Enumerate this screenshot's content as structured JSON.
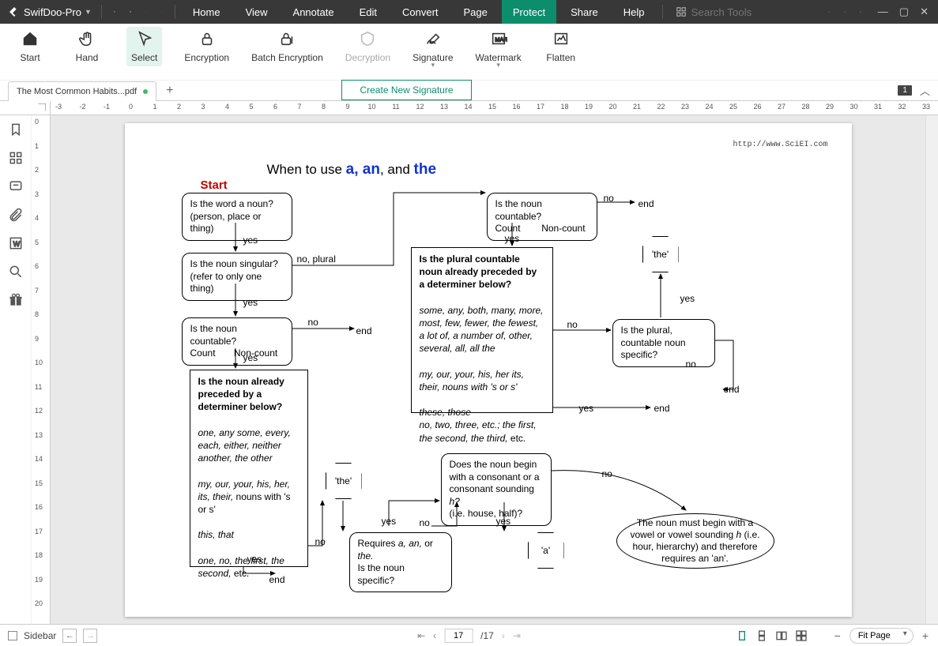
{
  "app": {
    "name": "SwifDoo-Pro"
  },
  "menus": [
    "Home",
    "View",
    "Annotate",
    "Edit",
    "Convert",
    "Page",
    "Protect",
    "Share",
    "Help"
  ],
  "active_menu": "Protect",
  "search_placeholder": "Search Tools",
  "ribbon": {
    "start": "Start",
    "hand": "Hand",
    "select": "Select",
    "encryption": "Encryption",
    "batch": "Batch Encryption",
    "decryption": "Decryption",
    "signature": "Signature",
    "watermark": "Watermark",
    "flatten": "Flatten"
  },
  "sig_dropdown": "Create New Signature",
  "tab": {
    "name": "The Most Common Habits...pdf"
  },
  "page_badge": "1",
  "h_ruler": [
    -3,
    -2,
    -1,
    0,
    1,
    2,
    3,
    4,
    5,
    6,
    7,
    8,
    9,
    10,
    11,
    12,
    13,
    14,
    15,
    16,
    17,
    18,
    19,
    20,
    21,
    22,
    23,
    24,
    25,
    26,
    27,
    28,
    29,
    30,
    31,
    32,
    33
  ],
  "v_ruler": [
    0,
    1,
    2,
    3,
    4,
    5,
    6,
    7,
    8,
    9,
    10,
    11,
    12,
    13,
    14,
    15,
    16,
    17,
    18,
    19,
    20
  ],
  "doc": {
    "url": "http://www.SciEI.com",
    "title_prefix": "When to use ",
    "title_a": "a, an",
    "title_and": ", and ",
    "title_the": "the",
    "start": "Start",
    "n1a": "Is the word a noun?",
    "n1b": "(person, place or thing)",
    "n2a": "Is the noun singular?",
    "n2b": "(refer to only one thing)",
    "n3a": "Is the noun countable?",
    "n3b": "Count",
    "n3c": "Non-count",
    "n4t": "Is the noun already preceded by a determiner below?",
    "n4a": "one, any some, every, each, either, neither another, the other",
    "n4b": "my, our, your, his, her, its, their, ",
    "n4b2": "nouns with 's or s'",
    "n4c": "this, that",
    "n4d": "one, no, the first, the second, ",
    "n4d2": "etc.",
    "n5a": "Is the noun countable?",
    "n5b": "Count",
    "n5c": "Non-count",
    "n6t": "Is the plural countable noun already preceded by a determiner below?",
    "n6a": "some, any, both, many, more, most, few, fewer, the fewest, a lot of, a number of, other, several, all, all the",
    "n6b": "my, our, your, his, her its, their, nouns with 's or s'",
    "n6c": "these, those",
    "n6d": "no, two, three, etc.; the first, the second, the third, ",
    "n6d2": "etc.",
    "n7": "Is the plural, countable noun specific?",
    "n8a": "Does the noun begin with a consonant or a consonant sounding ",
    "n8b": "h?",
    "n8c": "(i.e. house, half)?",
    "n9a": "Requires ",
    "n9b": "a, an, ",
    "n9c": "or ",
    "n9d": "the.",
    "n9e": "Is the noun specific?",
    "n10": "The noun must begin with a vowel or vowel sounding ",
    "n10b": "h",
    "n10c": " (i.e. hour, hierarchy) and therefore requires an 'an'.",
    "the": "'the'",
    "a": "'a'",
    "yes": "yes",
    "no": "no",
    "end": "end",
    "no_plural": "no, plural"
  },
  "status": {
    "sidebar": "Sidebar",
    "page_current": "17",
    "page_total": "/17",
    "fit": "Fit Page"
  }
}
